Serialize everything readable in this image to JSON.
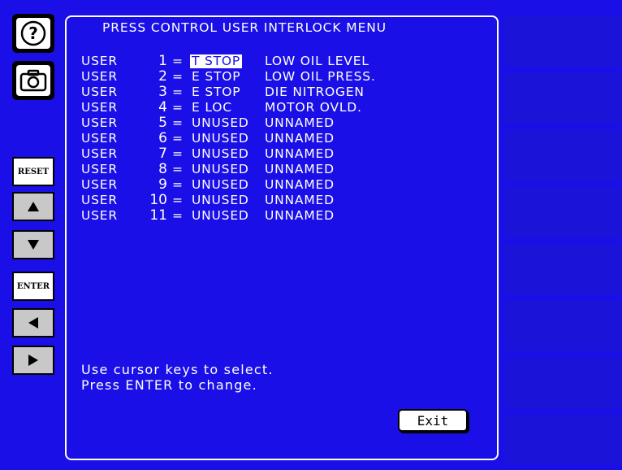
{
  "title": "PRESS CONTROL USER INTERLOCK MENU",
  "rows": [
    {
      "label": "USER",
      "num": "1",
      "eq": "=",
      "type": "T STOP",
      "name": "LOW OIL LEVEL"
    },
    {
      "label": "USER",
      "num": "2",
      "eq": "=",
      "type": "E STOP",
      "name": "LOW OIL PRESS."
    },
    {
      "label": "USER",
      "num": "3",
      "eq": "=",
      "type": "E STOP",
      "name": "DIE NITROGEN"
    },
    {
      "label": "USER",
      "num": "4",
      "eq": "=",
      "type": "E LOC",
      "name": "MOTOR OVLD."
    },
    {
      "label": "USER",
      "num": "5",
      "eq": "=",
      "type": "UNUSED",
      "name": "UNNAMED"
    },
    {
      "label": "USER",
      "num": "6",
      "eq": "=",
      "type": "UNUSED",
      "name": "UNNAMED"
    },
    {
      "label": "USER",
      "num": "7",
      "eq": "=",
      "type": "UNUSED",
      "name": "UNNAMED"
    },
    {
      "label": "USER",
      "num": "8",
      "eq": "=",
      "type": "UNUSED",
      "name": "UNNAMED"
    },
    {
      "label": "USER",
      "num": "9",
      "eq": "=",
      "type": "UNUSED",
      "name": "UNNAMED"
    },
    {
      "label": "USER",
      "num": "10",
      "eq": "=",
      "type": "UNUSED",
      "name": "UNNAMED"
    },
    {
      "label": "USER",
      "num": "11",
      "eq": "=",
      "type": "UNUSED",
      "name": "UNNAMED"
    }
  ],
  "help": {
    "line1": "Use cursor keys to select.",
    "line2": "Press ENTER to change."
  },
  "buttons": {
    "reset": "RESET",
    "enter": "ENTER",
    "exit": "Exit"
  },
  "icons": {
    "help": "help-icon",
    "camera": "camera-icon",
    "up": "arrow-up-icon",
    "down": "arrow-down-icon",
    "left": "arrow-left-icon",
    "right": "arrow-right-icon"
  },
  "colors": {
    "background": "#1a0fe6",
    "panel_border": "#ffffff",
    "text": "#ffffff",
    "selection_bg": "#ffffff",
    "selection_text": "#1a0fe6"
  }
}
